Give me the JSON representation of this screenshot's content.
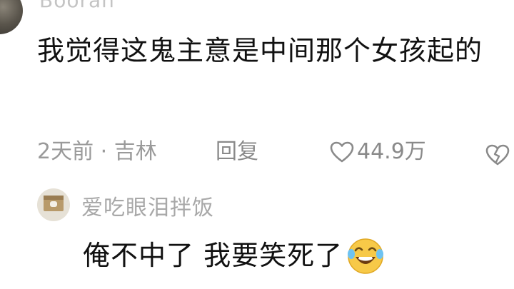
{
  "comment": {
    "username": "Booran",
    "text": "我觉得这鬼主意是中间那个女孩起的",
    "time_location": "2天前 · 吉林",
    "reply_label": "回复",
    "like_count": "44.9万",
    "icons": [
      "heart-outline-icon",
      "broken-heart-icon"
    ]
  },
  "reply": {
    "username": "爱吃眼泪拌饭",
    "text": "俺不中了 我要笑死了",
    "emoji": "crying-laughing-emoji"
  }
}
